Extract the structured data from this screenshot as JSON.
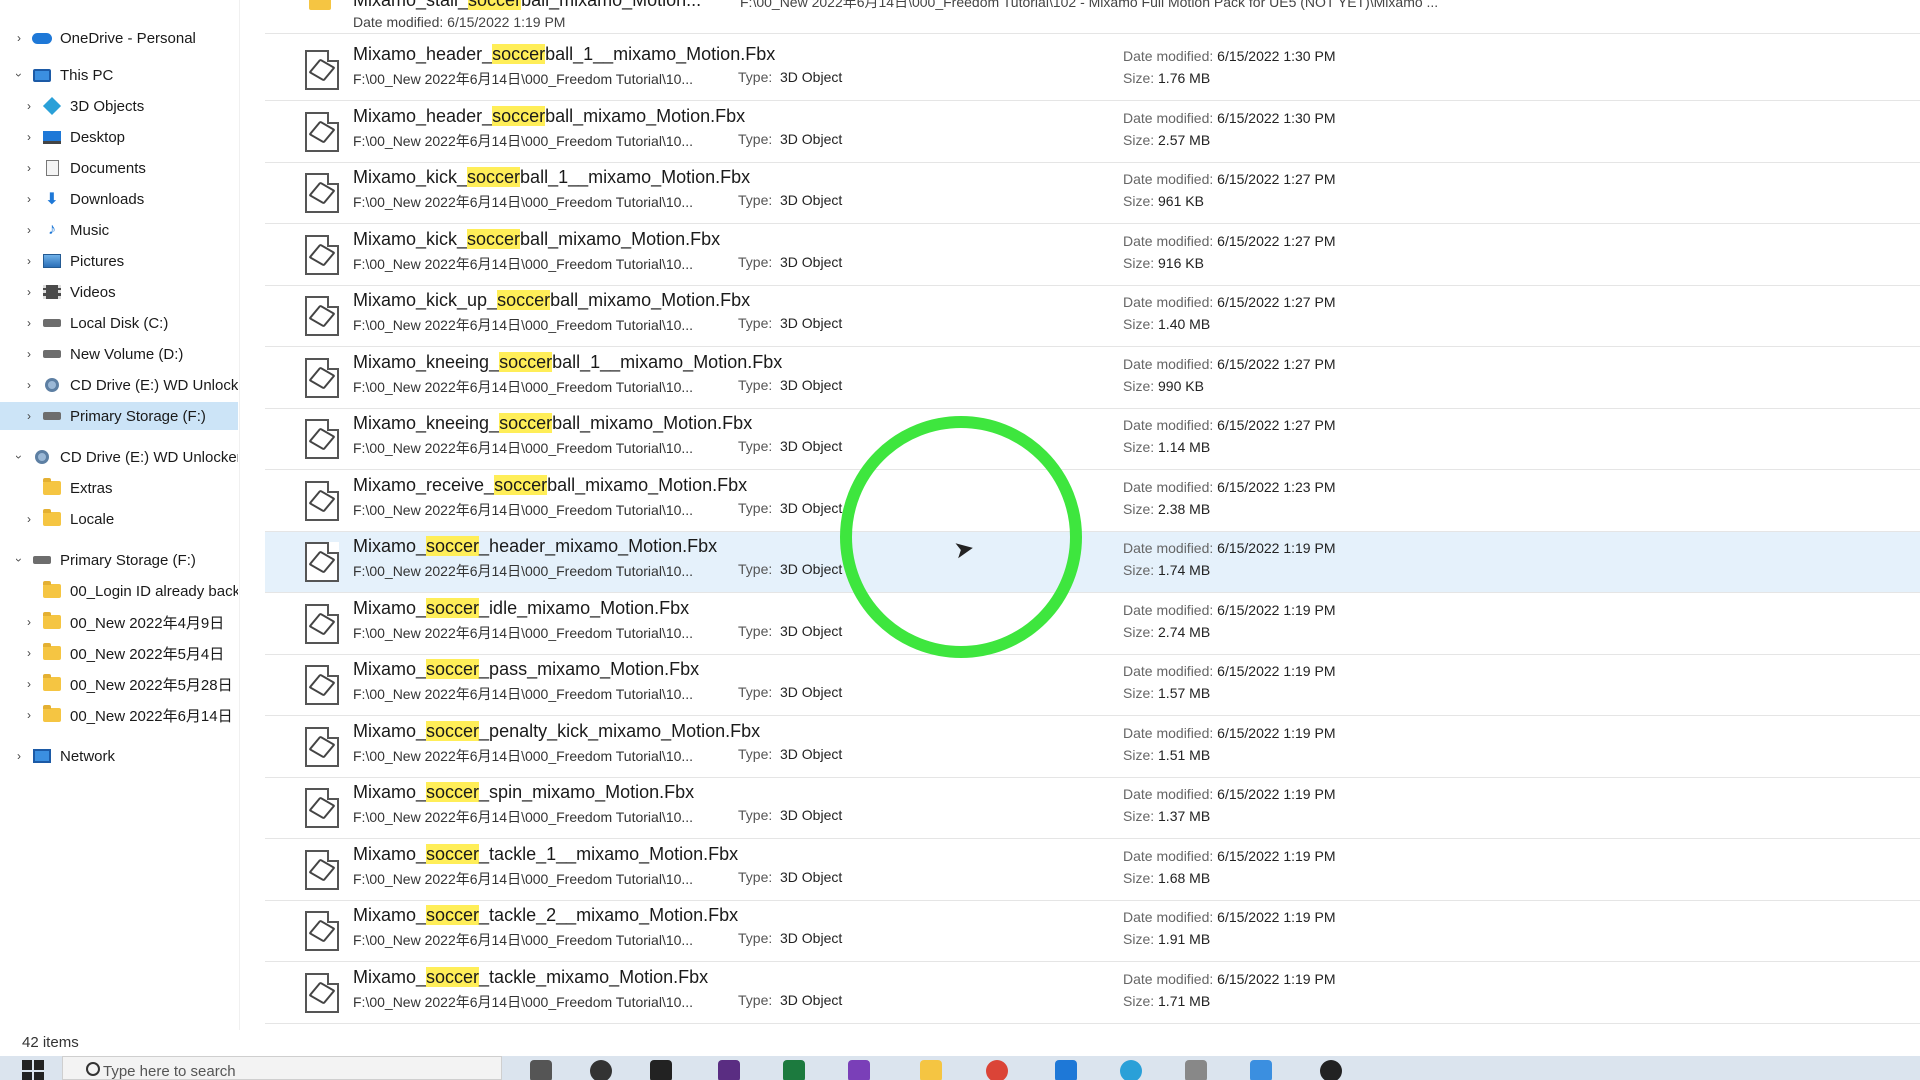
{
  "nav": {
    "items": [
      {
        "label": "OneDrive - Personal",
        "icon": "onedrive-icon",
        "chev": "right",
        "indent": 0,
        "selected": false
      },
      {
        "label": "This PC",
        "icon": "this-pc-icon",
        "chev": "down",
        "indent": 0,
        "selected": false
      },
      {
        "label": "3D Objects",
        "icon": "3d-objects-icon",
        "chev": "right",
        "indent": 1,
        "selected": false
      },
      {
        "label": "Desktop",
        "icon": "desktop-icon",
        "chev": "right",
        "indent": 1,
        "selected": false
      },
      {
        "label": "Documents",
        "icon": "documents-icon",
        "chev": "right",
        "indent": 1,
        "selected": false
      },
      {
        "label": "Downloads",
        "icon": "downloads-icon",
        "chev": "right",
        "indent": 1,
        "selected": false
      },
      {
        "label": "Music",
        "icon": "music-icon",
        "chev": "right",
        "indent": 1,
        "selected": false
      },
      {
        "label": "Pictures",
        "icon": "pictures-icon",
        "chev": "right",
        "indent": 1,
        "selected": false
      },
      {
        "label": "Videos",
        "icon": "videos-icon",
        "chev": "right",
        "indent": 1,
        "selected": false
      },
      {
        "label": "Local Disk (C:)",
        "icon": "local-disk-icon",
        "chev": "right",
        "indent": 1,
        "selected": false
      },
      {
        "label": "New Volume (D:)",
        "icon": "drive-icon",
        "chev": "right",
        "indent": 1,
        "selected": false
      },
      {
        "label": "CD Drive (E:) WD Unlock",
        "icon": "cd-drive-icon",
        "chev": "right",
        "indent": 1,
        "selected": false
      },
      {
        "label": "Primary Storage (F:)",
        "icon": "drive-icon",
        "chev": "right",
        "indent": 1,
        "selected": true
      },
      {
        "label": "CD Drive (E:) WD Unlocker",
        "icon": "cd-drive-icon",
        "chev": "down",
        "indent": 0,
        "selected": false
      },
      {
        "label": "Extras",
        "icon": "folder-icon",
        "chev": "none",
        "indent": 1,
        "selected": false
      },
      {
        "label": "Locale",
        "icon": "folder-icon",
        "chev": "right",
        "indent": 1,
        "selected": false
      },
      {
        "label": "Primary Storage (F:)",
        "icon": "drive-icon",
        "chev": "down",
        "indent": 0,
        "selected": false
      },
      {
        "label": "00_Login ID already back",
        "icon": "folder-icon",
        "chev": "none",
        "indent": 1,
        "selected": false
      },
      {
        "label": "00_New 2022年4月9日",
        "icon": "folder-icon",
        "chev": "right",
        "indent": 1,
        "selected": false
      },
      {
        "label": "00_New 2022年5月4日",
        "icon": "folder-icon",
        "chev": "right",
        "indent": 1,
        "selected": false
      },
      {
        "label": "00_New 2022年5月28日",
        "icon": "folder-icon",
        "chev": "right",
        "indent": 1,
        "selected": false
      },
      {
        "label": "00_New 2022年6月14日",
        "icon": "folder-icon",
        "chev": "right",
        "indent": 1,
        "selected": false
      },
      {
        "label": "Network",
        "icon": "network-icon",
        "chev": "right",
        "indent": 0,
        "selected": false
      }
    ]
  },
  "top_partial": {
    "name_pre": "Mixamo_stall_",
    "name_hl": "soccer",
    "name_post": "ball_mixamo_Motion...",
    "path": "F:\\00_New 2022年6月14日\\000_Freedom Tutorial\\102 - Mixamo Full Motion Pack for UE5 (NOT YET)\\Mixamo ...",
    "date_modified": "Date modified: 6/15/2022 1:19 PM"
  },
  "labels": {
    "type": "Type:",
    "date_modified": "Date modified:",
    "size": "Size:"
  },
  "files": [
    {
      "pre": "Mixamo_header_",
      "hl": "soccer",
      "post": "ball_1__mixamo_Motion.Fbx",
      "path": "F:\\00_New 2022年6月14日\\000_Freedom Tutorial\\10...",
      "type": "3D Object",
      "date": "6/15/2022 1:30 PM",
      "size": "1.76 MB",
      "selected": false
    },
    {
      "pre": "Mixamo_header_",
      "hl": "soccer",
      "post": "ball_mixamo_Motion.Fbx",
      "path": "F:\\00_New 2022年6月14日\\000_Freedom Tutorial\\10...",
      "type": "3D Object",
      "date": "6/15/2022 1:30 PM",
      "size": "2.57 MB",
      "selected": false
    },
    {
      "pre": "Mixamo_kick_",
      "hl": "soccer",
      "post": "ball_1__mixamo_Motion.Fbx",
      "path": "F:\\00_New 2022年6月14日\\000_Freedom Tutorial\\10...",
      "type": "3D Object",
      "date": "6/15/2022 1:27 PM",
      "size": "961 KB",
      "selected": false
    },
    {
      "pre": "Mixamo_kick_",
      "hl": "soccer",
      "post": "ball_mixamo_Motion.Fbx",
      "path": "F:\\00_New 2022年6月14日\\000_Freedom Tutorial\\10...",
      "type": "3D Object",
      "date": "6/15/2022 1:27 PM",
      "size": "916 KB",
      "selected": false
    },
    {
      "pre": "Mixamo_kick_up_",
      "hl": "soccer",
      "post": "ball_mixamo_Motion.Fbx",
      "path": "F:\\00_New 2022年6月14日\\000_Freedom Tutorial\\10...",
      "type": "3D Object",
      "date": "6/15/2022 1:27 PM",
      "size": "1.40 MB",
      "selected": false
    },
    {
      "pre": "Mixamo_kneeing_",
      "hl": "soccer",
      "post": "ball_1__mixamo_Motion.Fbx",
      "path": "F:\\00_New 2022年6月14日\\000_Freedom Tutorial\\10...",
      "type": "3D Object",
      "date": "6/15/2022 1:27 PM",
      "size": "990 KB",
      "selected": false
    },
    {
      "pre": "Mixamo_kneeing_",
      "hl": "soccer",
      "post": "ball_mixamo_Motion.Fbx",
      "path": "F:\\00_New 2022年6月14日\\000_Freedom Tutorial\\10...",
      "type": "3D Object",
      "date": "6/15/2022 1:27 PM",
      "size": "1.14 MB",
      "selected": false
    },
    {
      "pre": "Mixamo_receive_",
      "hl": "soccer",
      "post": "ball_mixamo_Motion.Fbx",
      "path": "F:\\00_New 2022年6月14日\\000_Freedom Tutorial\\10...",
      "type": "3D Object",
      "date": "6/15/2022 1:23 PM",
      "size": "2.38 MB",
      "selected": false
    },
    {
      "pre": "Mixamo_",
      "hl": "soccer",
      "post": "_header_mixamo_Motion.Fbx",
      "path": "F:\\00_New 2022年6月14日\\000_Freedom Tutorial\\10...",
      "type": "3D Object",
      "date": "6/15/2022 1:19 PM",
      "size": "1.74 MB",
      "selected": true
    },
    {
      "pre": "Mixamo_",
      "hl": "soccer",
      "post": "_idle_mixamo_Motion.Fbx",
      "path": "F:\\00_New 2022年6月14日\\000_Freedom Tutorial\\10...",
      "type": "3D Object",
      "date": "6/15/2022 1:19 PM",
      "size": "2.74 MB",
      "selected": false
    },
    {
      "pre": "Mixamo_",
      "hl": "soccer",
      "post": "_pass_mixamo_Motion.Fbx",
      "path": "F:\\00_New 2022年6月14日\\000_Freedom Tutorial\\10...",
      "type": "3D Object",
      "date": "6/15/2022 1:19 PM",
      "size": "1.57 MB",
      "selected": false
    },
    {
      "pre": "Mixamo_",
      "hl": "soccer",
      "post": "_penalty_kick_mixamo_Motion.Fbx",
      "path": "F:\\00_New 2022年6月14日\\000_Freedom Tutorial\\10...",
      "type": "3D Object",
      "date": "6/15/2022 1:19 PM",
      "size": "1.51 MB",
      "selected": false
    },
    {
      "pre": "Mixamo_",
      "hl": "soccer",
      "post": "_spin_mixamo_Motion.Fbx",
      "path": "F:\\00_New 2022年6月14日\\000_Freedom Tutorial\\10...",
      "type": "3D Object",
      "date": "6/15/2022 1:19 PM",
      "size": "1.37 MB",
      "selected": false
    },
    {
      "pre": "Mixamo_",
      "hl": "soccer",
      "post": "_tackle_1__mixamo_Motion.Fbx",
      "path": "F:\\00_New 2022年6月14日\\000_Freedom Tutorial\\10...",
      "type": "3D Object",
      "date": "6/15/2022 1:19 PM",
      "size": "1.68 MB",
      "selected": false
    },
    {
      "pre": "Mixamo_",
      "hl": "soccer",
      "post": "_tackle_2__mixamo_Motion.Fbx",
      "path": "F:\\00_New 2022年6月14日\\000_Freedom Tutorial\\10...",
      "type": "3D Object",
      "date": "6/15/2022 1:19 PM",
      "size": "1.91 MB",
      "selected": false
    },
    {
      "pre": "Mixamo_",
      "hl": "soccer",
      "post": "_tackle_mixamo_Motion.Fbx",
      "path": "F:\\00_New 2022年6月14日\\000_Freedom Tutorial\\10...",
      "type": "3D Object",
      "date": "6/15/2022 1:19 PM",
      "size": "1.71 MB",
      "selected": false
    }
  ],
  "status": {
    "items_count": "42 items"
  },
  "taskbar": {
    "search_placeholder": "Type here to search"
  },
  "colors": {
    "highlight": "#ffee58",
    "selection": "#cce4f7",
    "ring": "#3ee63e"
  }
}
